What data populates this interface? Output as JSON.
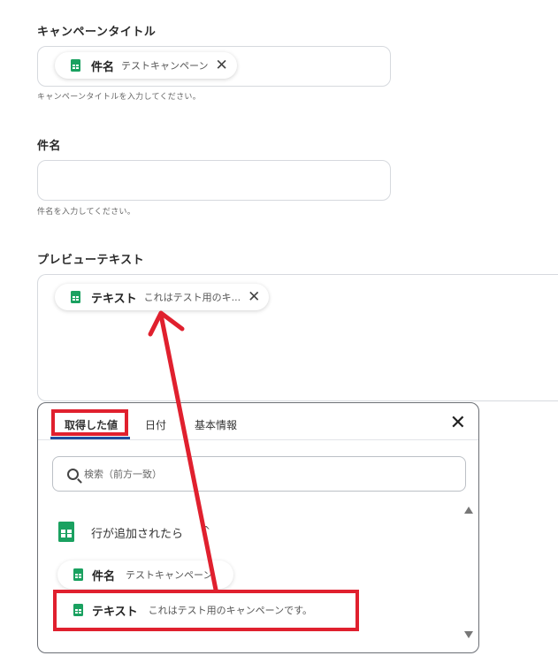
{
  "campaign_title": {
    "label": "キャンペーンタイトル",
    "chip_name": "件名",
    "chip_value": "テストキャンペーン",
    "hint": "キャンペーンタイトルを入力してください。"
  },
  "subject": {
    "label": "件名",
    "value": "",
    "hint": "件名を入力してください。"
  },
  "preview_text": {
    "label": "プレビューテキスト",
    "chip_name": "テキスト",
    "chip_value": "これはテスト用のキ..."
  },
  "picker": {
    "tabs": [
      {
        "label": "取得した値"
      },
      {
        "label": "日付"
      },
      {
        "label": "基本情報"
      }
    ],
    "search_placeholder": "検索（前方一致）",
    "group_title": "行が追加されたら",
    "group_caret": "^",
    "items": [
      {
        "name": "件名",
        "value": "テストキャンペーン"
      },
      {
        "name": "テキスト",
        "value": "これはテスト用のキャンペーンです。"
      }
    ]
  },
  "colors": {
    "annotation_red": "#e0202e",
    "sheets_green": "#1aa160",
    "active_tab_underline": "#1f4ea0"
  },
  "icons": {
    "chip_icon": "google-sheets-icon",
    "close": "close-icon",
    "search": "search-icon"
  }
}
